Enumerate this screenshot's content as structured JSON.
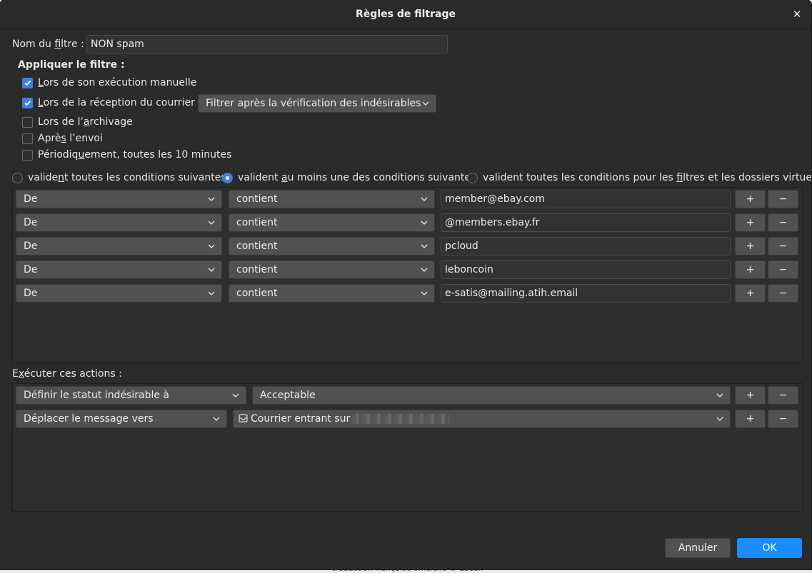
{
  "dialog": {
    "title": "Règles de filtrage",
    "close_icon": "close-icon"
  },
  "filter_name": {
    "label_before": "Nom du ",
    "label_accel": "f",
    "label_after": "iltre :",
    "value": "NON spam"
  },
  "apply": {
    "heading": "Appliquer le filtre :",
    "options": [
      {
        "before": "",
        "accel": "L",
        "after": "ors de son exécution manuelle",
        "checked": true
      },
      {
        "before": "",
        "accel": "L",
        "after": "ors de la réception du courrier :",
        "checked": true
      },
      {
        "before": "Lors de l’",
        "accel": "a",
        "after": "rchivage",
        "checked": false
      },
      {
        "before": "Aprè",
        "accel": "s",
        "after": " l’envoi",
        "checked": false
      },
      {
        "before": "Périodiq",
        "accel": "u",
        "after": "ement, toutes les 10 minutes",
        "checked": false
      }
    ],
    "reception_select": "Filtrer après la vérification des indésirables"
  },
  "match": {
    "options": [
      {
        "before": "valide",
        "accel": "n",
        "after": "t toutes les conditions suivantes",
        "selected": false
      },
      {
        "before": "valident ",
        "accel": "a",
        "after": "u moins une des conditions suivantes",
        "selected": true
      },
      {
        "before": "valident toutes les conditions pour les ",
        "accel": "f",
        "after": "iltres et les dossiers virtuels",
        "selected": false
      }
    ]
  },
  "conditions": [
    {
      "field": "De",
      "operator": "contient",
      "value": "member@ebay.com"
    },
    {
      "field": "De",
      "operator": "contient",
      "value": "@members.ebay.fr"
    },
    {
      "field": "De",
      "operator": "contient",
      "value": "pcloud"
    },
    {
      "field": "De",
      "operator": "contient",
      "value": "leboncoin"
    },
    {
      "field": "De",
      "operator": "contient",
      "value": "e-satis@mailing.atih.email"
    }
  ],
  "row_buttons": {
    "add": "+",
    "remove": "−"
  },
  "actions": {
    "heading_before": "E",
    "heading_accel": "x",
    "heading_after": "écuter ces actions :",
    "items": [
      {
        "action": "Définir le statut indésirable à",
        "target": "Acceptable"
      },
      {
        "action": "Déplacer le message vers",
        "target": "Courrier entrant sur"
      }
    ]
  },
  "footer": {
    "cancel": "Annuler",
    "ok": "OK"
  },
  "background_text": "traduction française officielle © Lüeen",
  "colors": {
    "accent": "#3d7fe0",
    "window_bg": "#2b2b2b",
    "button_bg": "#505250",
    "ok_bg": "#1a8cff"
  }
}
